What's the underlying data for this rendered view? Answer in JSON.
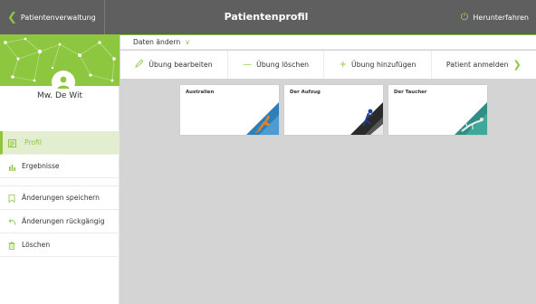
{
  "header": {
    "back_label": "Patientenverwaltung",
    "title": "Patientenprofil",
    "shutdown_label": "Herunterfahren"
  },
  "colors": {
    "accent": "#8dc63f",
    "topbar": "#5f5f5f",
    "content_bg": "#d4d4d4"
  },
  "patient": {
    "name": "Mw. De Wit"
  },
  "sidebar": {
    "nav": [
      {
        "label": "Profil",
        "icon": "profile-icon",
        "active": true
      },
      {
        "label": "Ergebnisse",
        "icon": "bar-chart-icon",
        "active": false
      }
    ],
    "actions": [
      {
        "label": "Änderungen speichern",
        "icon": "bookmark-icon"
      },
      {
        "label": "Änderungen rückgängig",
        "icon": "undo-icon"
      },
      {
        "label": "Löschen",
        "icon": "trash-icon"
      }
    ]
  },
  "main": {
    "data_change_label": "Daten ändern",
    "toolbar": {
      "edit_label": "Übung bearbeiten",
      "delete_label": "Übung löschen",
      "add_label": "Übung hinzufügen",
      "register_label": "Patient anmelden"
    },
    "exercises": [
      {
        "title": "Australien",
        "icon": "kangaroo-icon"
      },
      {
        "title": "Der Aufzug",
        "icon": "climber-icon"
      },
      {
        "title": "Der Taucher",
        "icon": "diver-icon"
      }
    ]
  }
}
